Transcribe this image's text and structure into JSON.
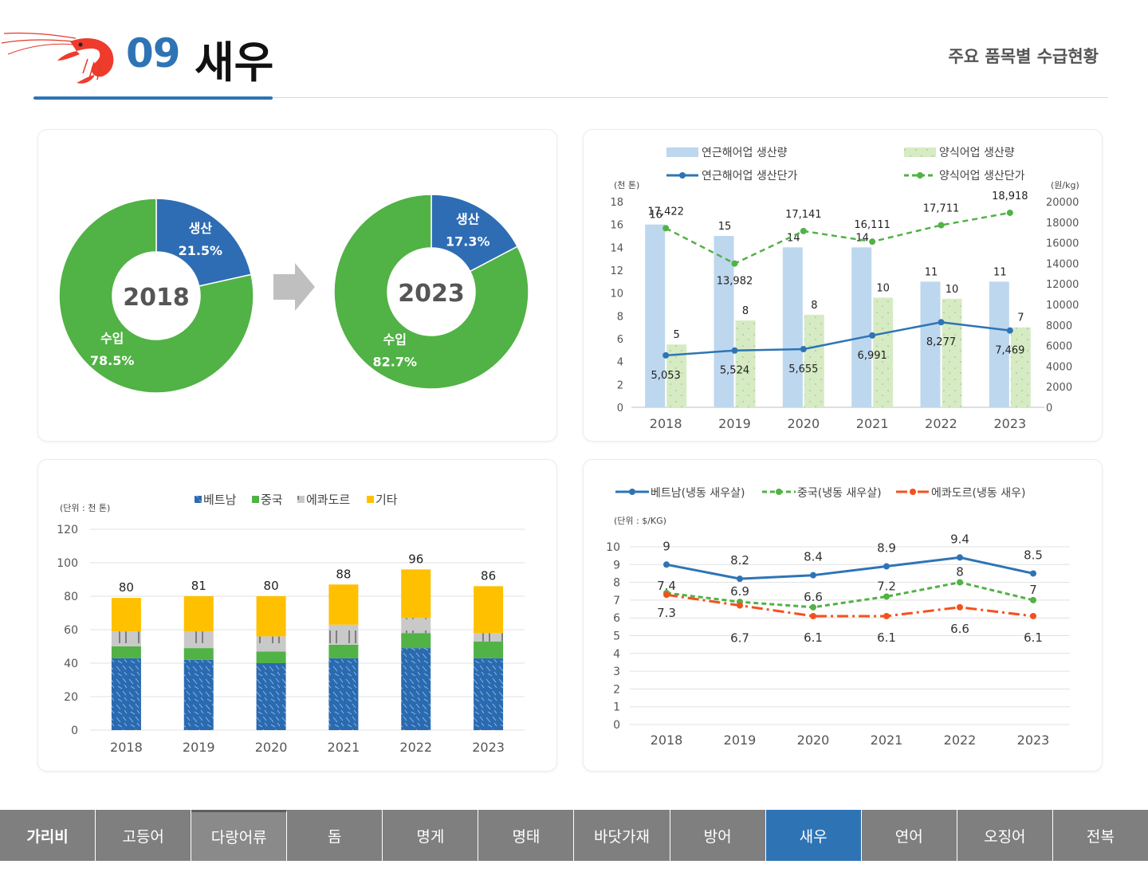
{
  "header": {
    "number": "09",
    "title": "새우",
    "subtitle": "주요 품목별 수급현황"
  },
  "nav": [
    {
      "label": "가리비",
      "state": "first"
    },
    {
      "label": "고등어",
      "state": ""
    },
    {
      "label": "다랑어류",
      "state": "hl"
    },
    {
      "label": "돔",
      "state": ""
    },
    {
      "label": "명게",
      "state": ""
    },
    {
      "label": "명태",
      "state": ""
    },
    {
      "label": "바닷가재",
      "state": ""
    },
    {
      "label": "방어",
      "state": ""
    },
    {
      "label": "새우",
      "state": "active"
    },
    {
      "label": "연어",
      "state": ""
    },
    {
      "label": "오징어",
      "state": ""
    },
    {
      "label": "전복",
      "state": ""
    }
  ],
  "colors": {
    "blue": "#2e74b5",
    "green": "#51b245",
    "gray": "#c8c8c8",
    "orange": "#f4511e",
    "yellow": "#ffc000",
    "navy": "#2a6ab0",
    "lightblue": "#bdd7ee",
    "lightgreen": "#d6ebc4"
  },
  "chart_data": [
    {
      "type": "pie",
      "title": "2018",
      "slices": [
        {
          "label": "생산",
          "value": 21.5,
          "display": "21.5%",
          "color": "#2e6db4"
        },
        {
          "label": "수입",
          "value": 78.5,
          "display": "78.5%",
          "color": "#51b245"
        }
      ]
    },
    {
      "type": "pie",
      "title": "2023",
      "slices": [
        {
          "label": "생산",
          "value": 17.3,
          "display": "17.3%",
          "color": "#2e6db4"
        },
        {
          "label": "수입",
          "value": 82.7,
          "display": "82.7%",
          "color": "#51b245"
        }
      ]
    },
    {
      "type": "bar",
      "categories": [
        "2018",
        "2019",
        "2020",
        "2021",
        "2022",
        "2023"
      ],
      "left_unit": "(천 톤)",
      "right_unit": "(원/kg)",
      "ylim": [
        0,
        18
      ],
      "y2lim": [
        0,
        20000
      ],
      "yticks": [
        0,
        2,
        4,
        6,
        8,
        10,
        12,
        14,
        16,
        18
      ],
      "y2ticks": [
        0,
        2000,
        4000,
        6000,
        8000,
        10000,
        12000,
        14000,
        16000,
        18000,
        20000
      ],
      "series": [
        {
          "name": "연근해어업 생산량",
          "kind": "bar",
          "values": [
            16,
            15,
            14,
            14,
            11,
            11
          ],
          "labels": [
            "16",
            "15",
            "14",
            "14",
            "11",
            "11"
          ]
        },
        {
          "name": "양식어업 생산량",
          "kind": "bar",
          "values": [
            5.5,
            7.6,
            8.1,
            9.6,
            9.5,
            7
          ],
          "labels": [
            "5",
            "8",
            "8",
            "10",
            "10",
            "7"
          ]
        },
        {
          "name": "연근해어업 생산단가",
          "kind": "line",
          "values": [
            5053,
            5524,
            5655,
            6991,
            8277,
            7469
          ],
          "labels": [
            "5,053",
            "5,524",
            "5,655",
            "6,991",
            "8,277",
            "7,469"
          ]
        },
        {
          "name": "양식어업 생산단가",
          "kind": "line",
          "values": [
            17422,
            13982,
            17141,
            16111,
            17711,
            18918
          ],
          "labels": [
            "17,422",
            "13,982",
            "17,141",
            "16,111",
            "17,711",
            "18,918"
          ]
        }
      ]
    },
    {
      "type": "bar",
      "stacked": true,
      "unit": "(단위 : 천 톤)",
      "categories": [
        "2018",
        "2019",
        "2020",
        "2021",
        "2022",
        "2023"
      ],
      "ylim": [
        0,
        120
      ],
      "yticks": [
        0,
        20,
        40,
        60,
        80,
        100,
        120
      ],
      "totals": [
        "80",
        "81",
        "80",
        "88",
        "96",
        "86"
      ],
      "series": [
        {
          "name": "베트남",
          "values": [
            43,
            42,
            40,
            43,
            49,
            43
          ]
        },
        {
          "name": "중국",
          "values": [
            7,
            7,
            7,
            8,
            9,
            10
          ]
        },
        {
          "name": "에콰도르",
          "values": [
            9,
            10,
            9,
            12,
            9,
            5
          ]
        },
        {
          "name": "기타",
          "values": [
            20,
            21,
            24,
            24,
            29,
            28
          ]
        }
      ]
    },
    {
      "type": "line",
      "unit": "(단위 : $/KG)",
      "categories": [
        "2018",
        "2019",
        "2020",
        "2021",
        "2022",
        "2023"
      ],
      "ylim": [
        0,
        10
      ],
      "yticks": [
        0,
        1,
        2,
        3,
        4,
        5,
        6,
        7,
        8,
        9,
        10
      ],
      "series": [
        {
          "name": "베트남(냉동 새우살)",
          "values": [
            9,
            8.2,
            8.4,
            8.9,
            9.4,
            8.5
          ],
          "labels": [
            "9",
            "8.2",
            "8.4",
            "8.9",
            "9.4",
            "8.5"
          ]
        },
        {
          "name": "중국(냉동 새우살)",
          "values": [
            7.4,
            6.9,
            6.6,
            7.2,
            8,
            7
          ],
          "labels": [
            "7.4",
            "6.9",
            "6.6",
            "7.2",
            "8",
            "7"
          ]
        },
        {
          "name": "에콰도르(냉동 새우)",
          "values": [
            7.3,
            6.7,
            6.1,
            6.1,
            6.6,
            6.1
          ],
          "labels": [
            "7.3",
            "6.7",
            "6.1",
            "6.1",
            "6.6",
            "6.1"
          ]
        }
      ]
    }
  ]
}
